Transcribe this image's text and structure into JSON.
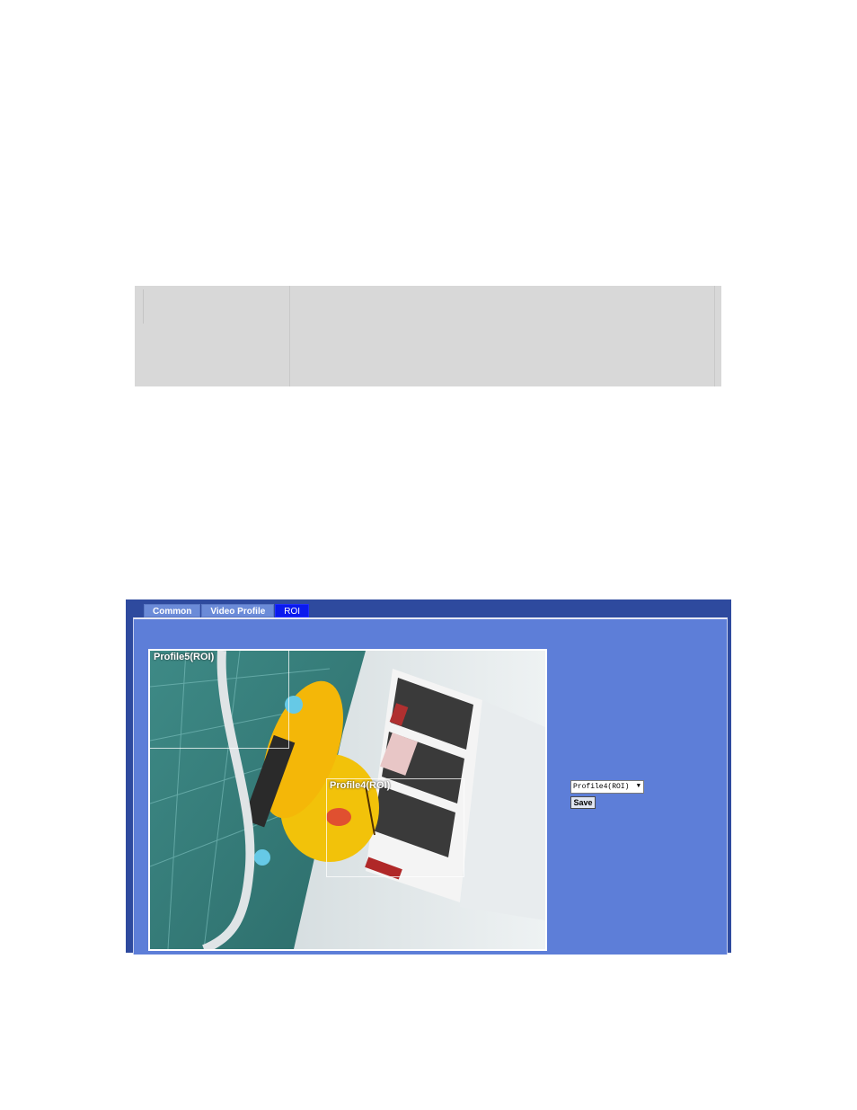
{
  "tabs": [
    {
      "label": "Common",
      "active": false
    },
    {
      "label": "Video Profile",
      "active": false
    },
    {
      "label": "ROI",
      "active": true
    }
  ],
  "video": {
    "roi_profile5_label": "Profile5(ROI)",
    "roi_profile4_label": "Profile4(ROI)"
  },
  "controls": {
    "profile_select_value": "Profile4(ROI)",
    "save_label": "Save"
  },
  "colors": {
    "frame": "#2e4a9e",
    "panel": "#5d7ed8",
    "active_tab": "#0a1aee",
    "tab": "#6b8bd8"
  }
}
